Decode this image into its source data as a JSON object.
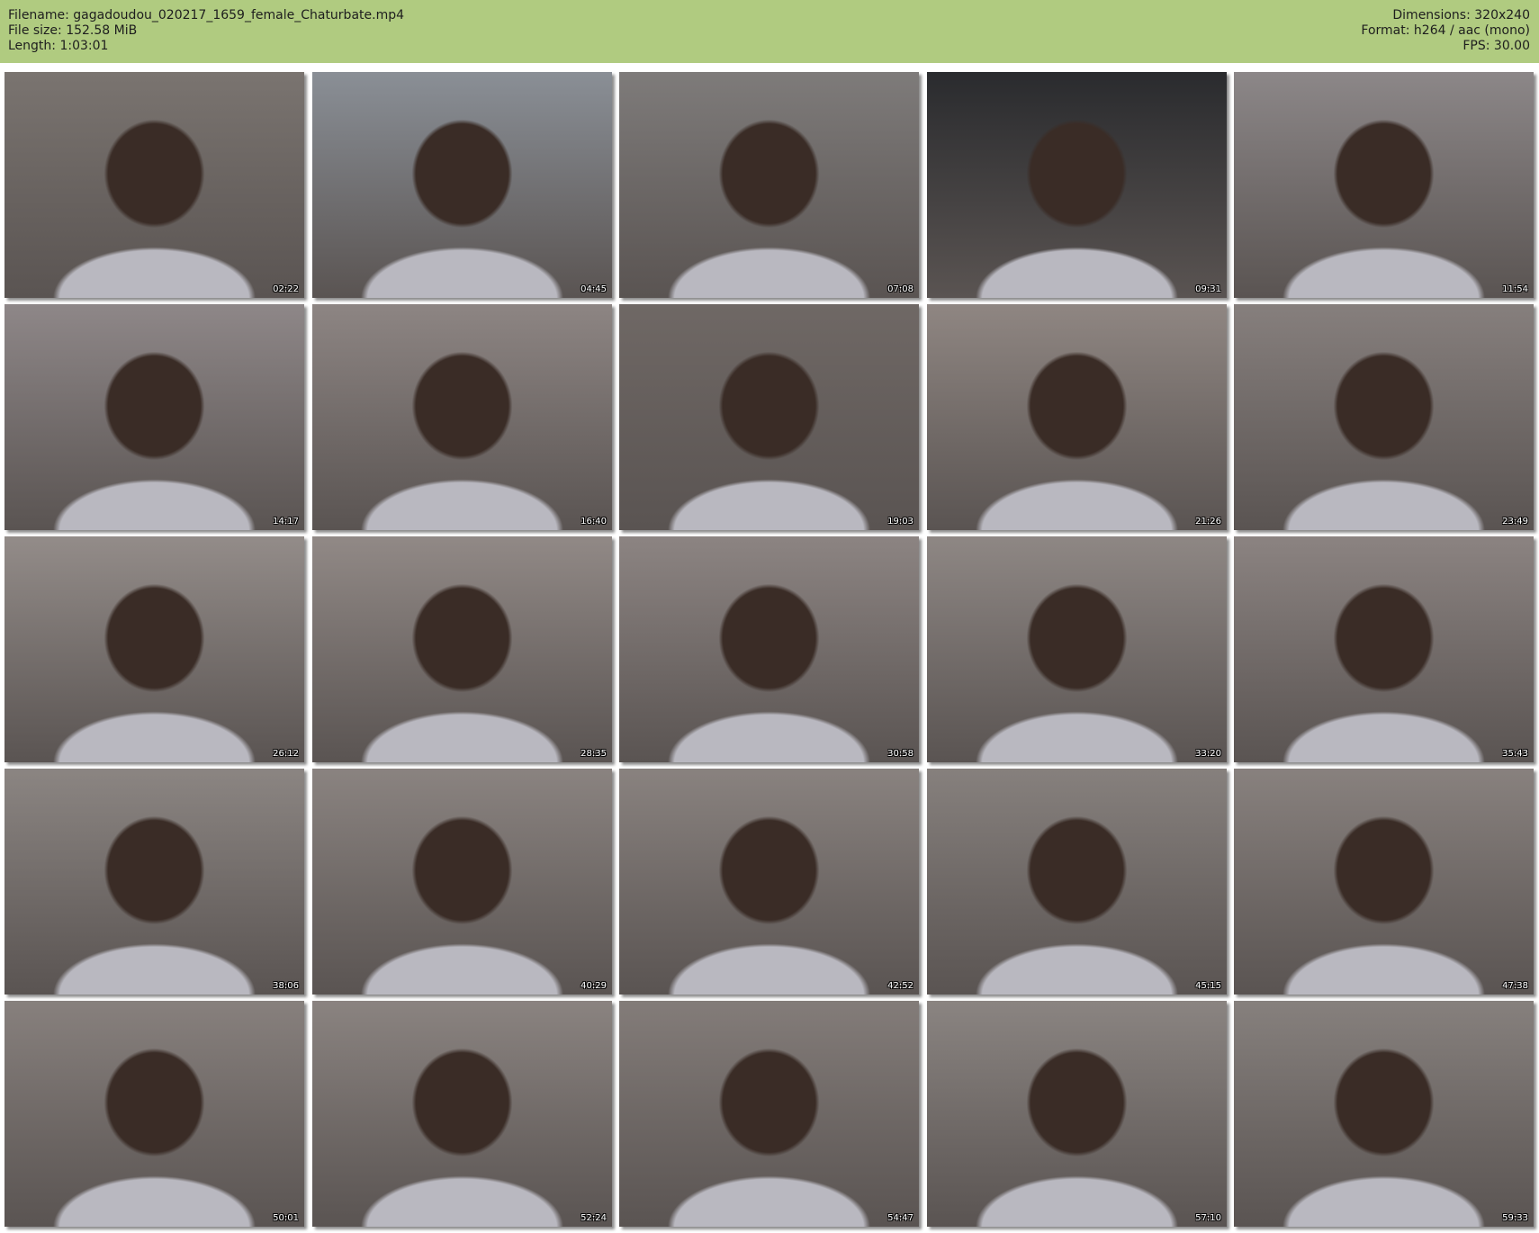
{
  "header": {
    "filename": "Filename: gagadoudou_020217_1659_female_Chaturbate.mp4",
    "file_size": "File size: 152.58 MiB",
    "length": "Length: 1:03:01",
    "dimensions": "Dimensions: 320x240",
    "format": "Format: h264 / aac (mono)",
    "fps": "FPS: 30.00"
  },
  "colors": {
    "header_bg": "#b0cb80",
    "page_bg": "#ffffff"
  },
  "thumbnails": [
    {
      "time": "02:22",
      "tone": "#7a7470"
    },
    {
      "time": "04:45",
      "tone": "#8a8f96"
    },
    {
      "time": "07:08",
      "tone": "#7e7b7a"
    },
    {
      "time": "09:31",
      "tone": "#2a2b2e"
    },
    {
      "time": "11:54",
      "tone": "#8c8788"
    },
    {
      "time": "14:17",
      "tone": "#8e8788"
    },
    {
      "time": "16:40",
      "tone": "#8d8583"
    },
    {
      "time": "19:03",
      "tone": "#6f6865"
    },
    {
      "time": "21:26",
      "tone": "#8f8682"
    },
    {
      "time": "23:49",
      "tone": "#867f7d"
    },
    {
      "time": "26:12",
      "tone": "#938c89"
    },
    {
      "time": "28:35",
      "tone": "#918986"
    },
    {
      "time": "30:58",
      "tone": "#8c8482"
    },
    {
      "time": "33:20",
      "tone": "#8e8784"
    },
    {
      "time": "35:43",
      "tone": "#8b8381"
    },
    {
      "time": "38:06",
      "tone": "#8b8582"
    },
    {
      "time": "40:29",
      "tone": "#8a8380"
    },
    {
      "time": "42:52",
      "tone": "#89827f"
    },
    {
      "time": "45:15",
      "tone": "#86807d"
    },
    {
      "time": "47:38",
      "tone": "#88817e"
    },
    {
      "time": "50:01",
      "tone": "#87807d"
    },
    {
      "time": "52:24",
      "tone": "#8a8380"
    },
    {
      "time": "54:47",
      "tone": "#837c79"
    },
    {
      "time": "57:10",
      "tone": "#8a8481"
    },
    {
      "time": "59:33",
      "tone": "#86807d"
    }
  ]
}
